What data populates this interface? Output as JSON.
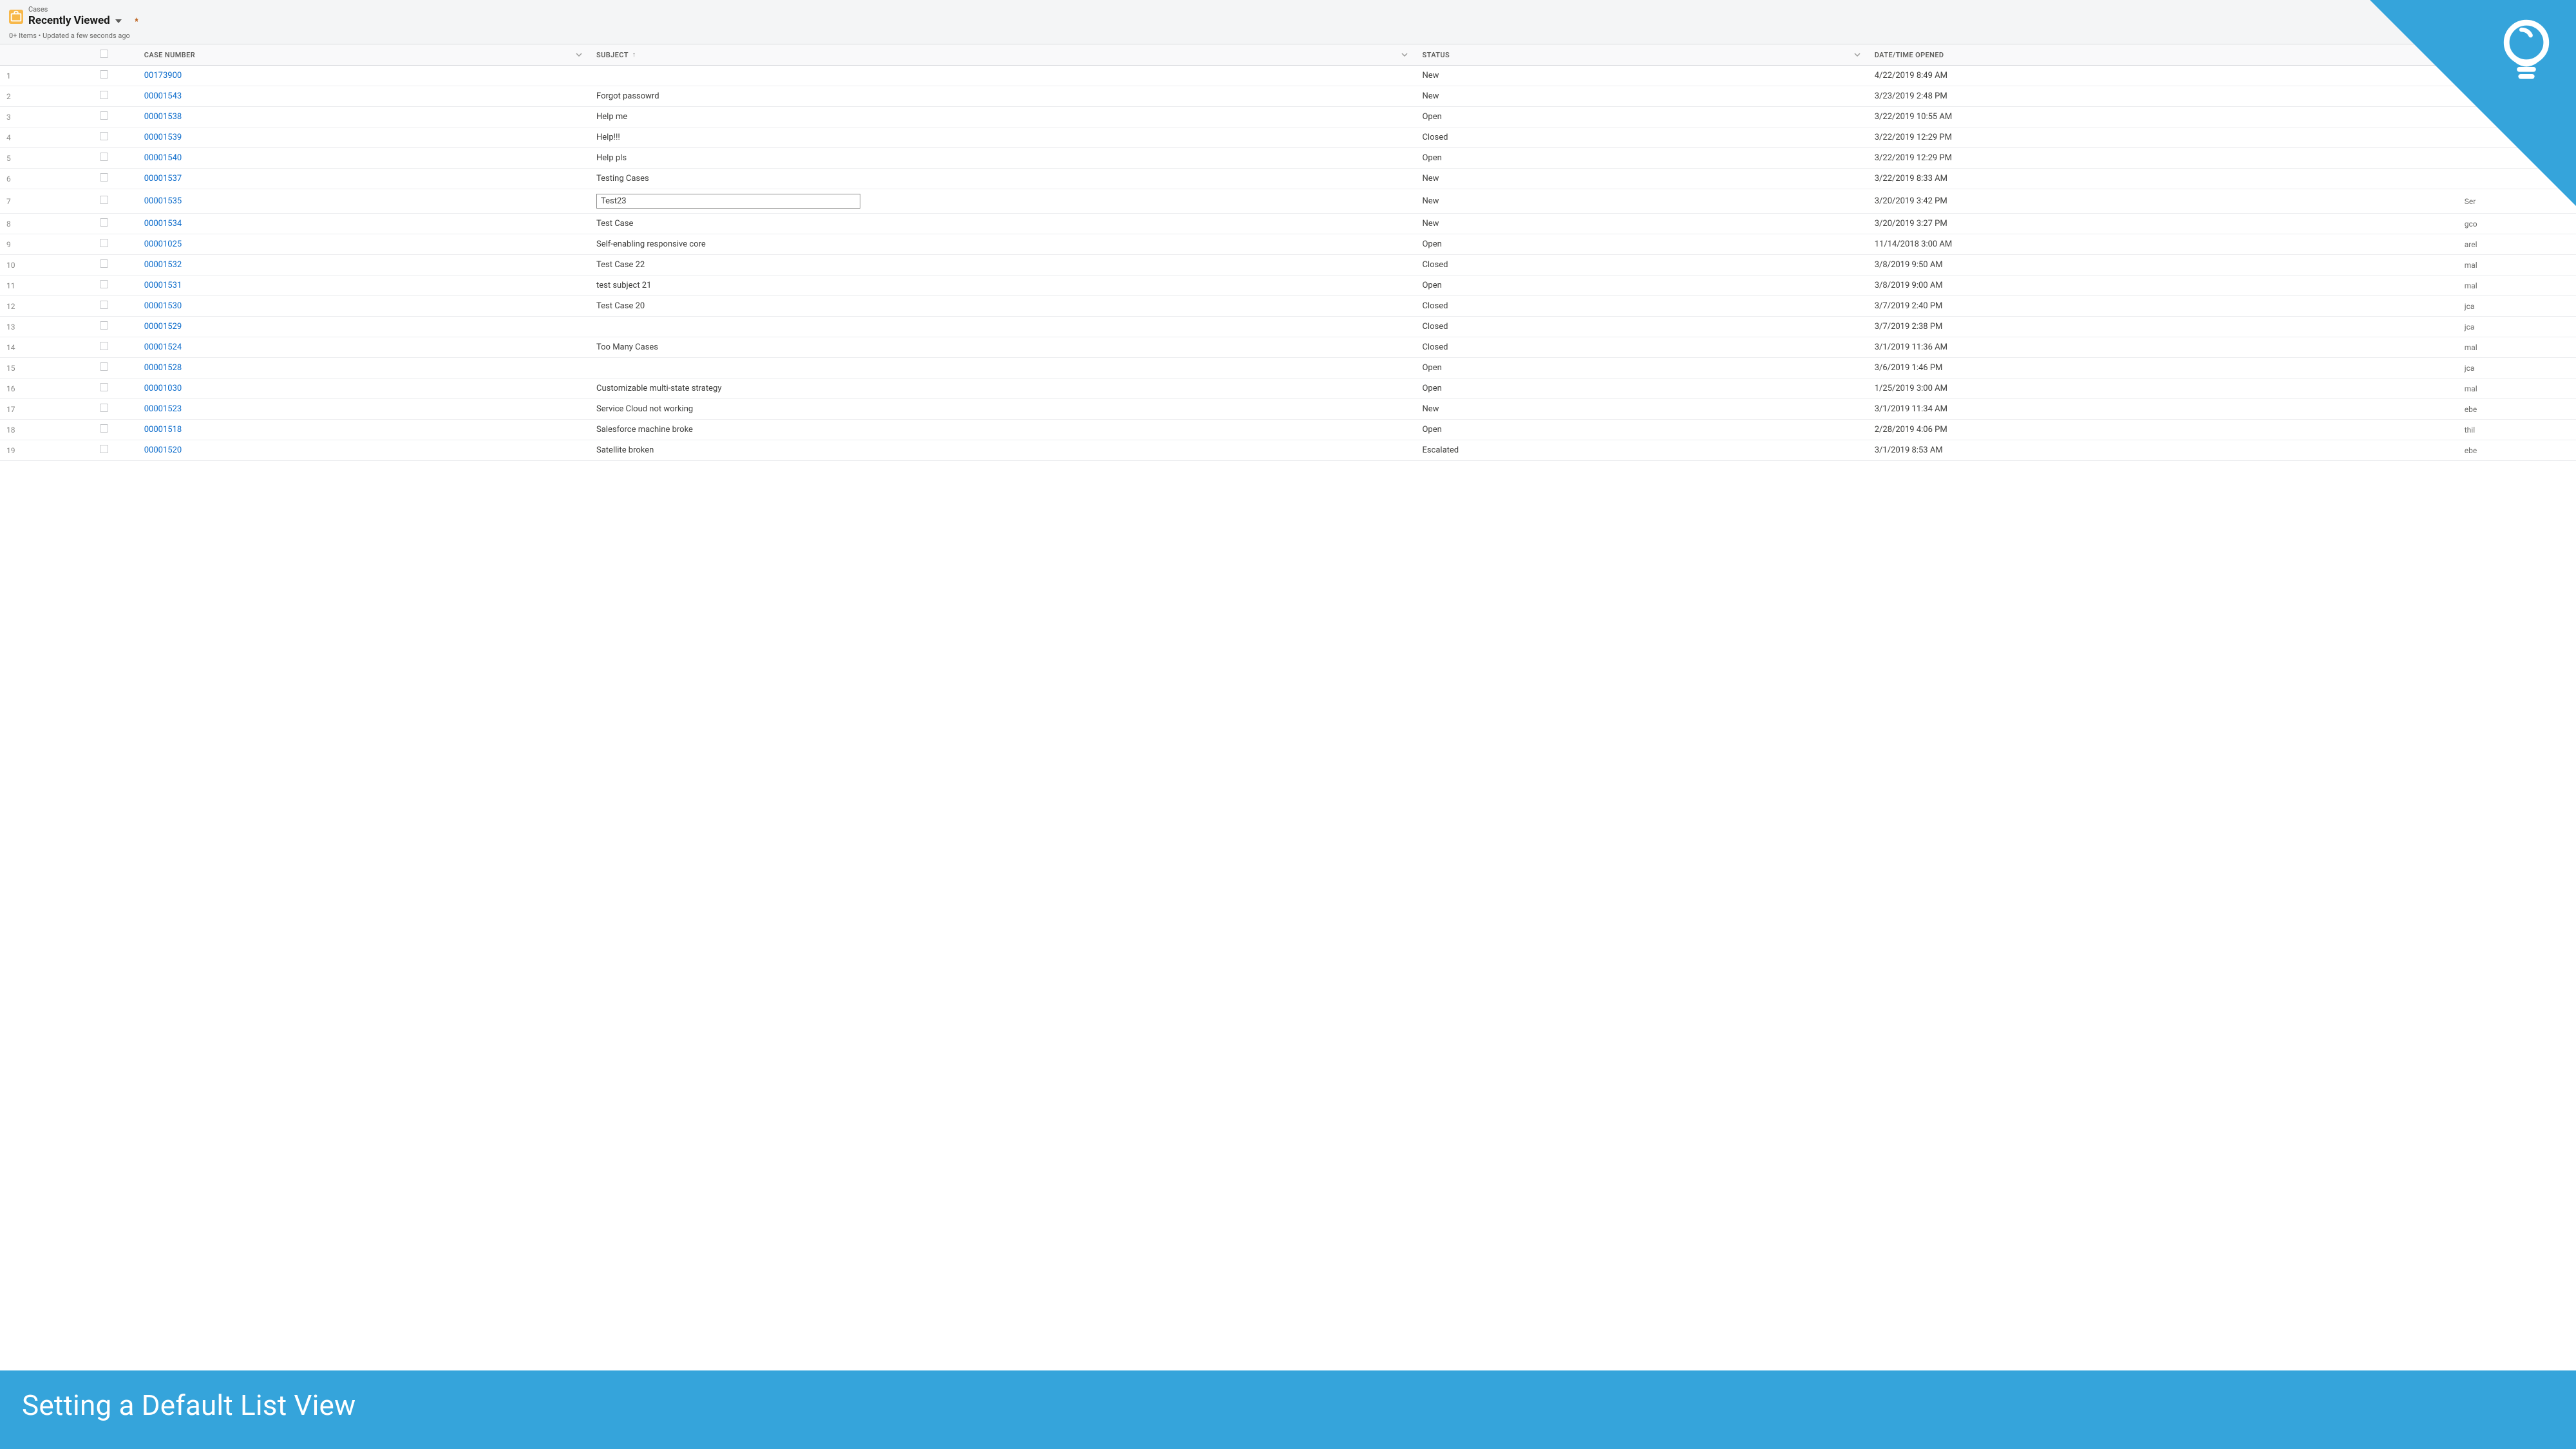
{
  "header": {
    "object_label": "Cases",
    "listview_name": "Recently Viewed",
    "sub_line": "0+ Items • Updated a few seconds ago"
  },
  "columns": {
    "case_number": "CASE NUMBER",
    "subject": "SUBJECT",
    "status": "STATUS",
    "date_opened": "DATE/TIME OPENED",
    "subject_sort_indicator": "↑"
  },
  "rows": [
    {
      "n": "1",
      "case": "00173900",
      "subject": "",
      "status": "New",
      "date": "4/22/2019 8:49 AM",
      "extra": ""
    },
    {
      "n": "2",
      "case": "00001543",
      "subject": "Forgot passowrd",
      "status": "New",
      "date": "3/23/2019 2:48 PM",
      "extra": ""
    },
    {
      "n": "3",
      "case": "00001538",
      "subject": "Help me",
      "status": "Open",
      "date": "3/22/2019 10:55 AM",
      "extra": ""
    },
    {
      "n": "4",
      "case": "00001539",
      "subject": "Help!!!",
      "status": "Closed",
      "date": "3/22/2019 12:29 PM",
      "extra": ""
    },
    {
      "n": "5",
      "case": "00001540",
      "subject": "Help pls",
      "status": "Open",
      "date": "3/22/2019 12:29 PM",
      "extra": ""
    },
    {
      "n": "6",
      "case": "00001537",
      "subject": "Testing Cases",
      "status": "New",
      "date": "3/22/2019 8:33 AM",
      "extra": ""
    },
    {
      "n": "7",
      "case": "00001535",
      "subject": "Test23",
      "status": "New",
      "date": "3/20/2019 3:42 PM",
      "extra": "Ser"
    },
    {
      "n": "8",
      "case": "00001534",
      "subject": "Test Case",
      "status": "New",
      "date": "3/20/2019 3:27 PM",
      "extra": "gco"
    },
    {
      "n": "9",
      "case": "00001025",
      "subject": "Self-enabling responsive core",
      "status": "Open",
      "date": "11/14/2018 3:00 AM",
      "extra": "arel"
    },
    {
      "n": "10",
      "case": "00001532",
      "subject": "Test Case 22",
      "status": "Closed",
      "date": "3/8/2019 9:50 AM",
      "extra": "mal"
    },
    {
      "n": "11",
      "case": "00001531",
      "subject": "test subject 21",
      "status": "Open",
      "date": "3/8/2019 9:00 AM",
      "extra": "mal"
    },
    {
      "n": "12",
      "case": "00001530",
      "subject": "Test Case 20",
      "status": "Closed",
      "date": "3/7/2019 2:40 PM",
      "extra": "jca"
    },
    {
      "n": "13",
      "case": "00001529",
      "subject": "",
      "status": "Closed",
      "date": "3/7/2019 2:38 PM",
      "extra": "jca"
    },
    {
      "n": "14",
      "case": "00001524",
      "subject": "Too Many Cases",
      "status": "Closed",
      "date": "3/1/2019 11:36 AM",
      "extra": "mal"
    },
    {
      "n": "15",
      "case": "00001528",
      "subject": "",
      "status": "Open",
      "date": "3/6/2019 1:46 PM",
      "extra": "jca"
    },
    {
      "n": "16",
      "case": "00001030",
      "subject": "Customizable multi-state strategy",
      "status": "Open",
      "date": "1/25/2019 3:00 AM",
      "extra": "mal"
    },
    {
      "n": "17",
      "case": "00001523",
      "subject": "Service Cloud not working",
      "status": "New",
      "date": "3/1/2019 11:34 AM",
      "extra": "ebe"
    },
    {
      "n": "18",
      "case": "00001518",
      "subject": "Salesforce machine broke",
      "status": "Open",
      "date": "2/28/2019 4:06 PM",
      "extra": "thil"
    },
    {
      "n": "19",
      "case": "00001520",
      "subject": "Satellite broken",
      "status": "Escalated",
      "date": "3/1/2019 8:53 AM",
      "extra": "ebe"
    }
  ],
  "editing_row_index": 6,
  "banner": {
    "title": "Setting a Default List View"
  },
  "colors": {
    "accent": "#35a4db",
    "link": "#0b6bcb",
    "object_icon": "#f7b84a"
  }
}
